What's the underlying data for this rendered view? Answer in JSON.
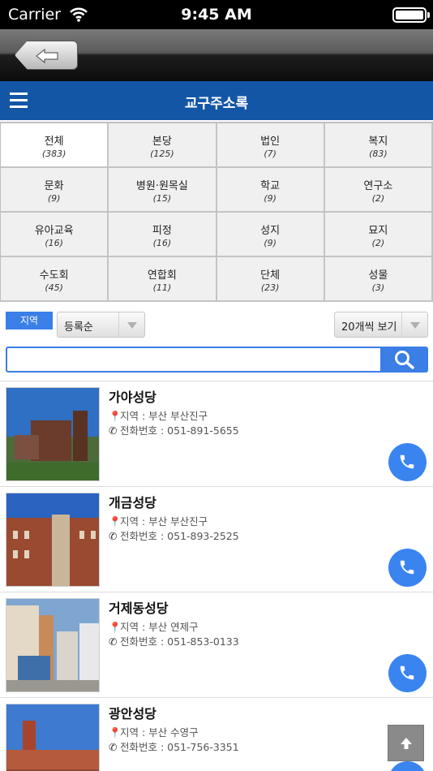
{
  "status_bar": {
    "carrier": "Carrier",
    "time": "9:45 AM"
  },
  "header": {
    "title": "교구주소록"
  },
  "categories": [
    {
      "name": "전체",
      "count": "(383)"
    },
    {
      "name": "본당",
      "count": "(125)"
    },
    {
      "name": "법인",
      "count": "(7)"
    },
    {
      "name": "복지",
      "count": "(83)"
    },
    {
      "name": "문화",
      "count": "(9)"
    },
    {
      "name": "병원·원목실",
      "count": "(15)"
    },
    {
      "name": "학교",
      "count": "(9)"
    },
    {
      "name": "연구소",
      "count": "(2)"
    },
    {
      "name": "유아교육",
      "count": "(16)"
    },
    {
      "name": "피정",
      "count": "(16)"
    },
    {
      "name": "성지",
      "count": "(9)"
    },
    {
      "name": "묘지",
      "count": "(2)"
    },
    {
      "name": "수도회",
      "count": "(45)"
    },
    {
      "name": "연합회",
      "count": "(11)"
    },
    {
      "name": "단체",
      "count": "(23)"
    },
    {
      "name": "성물",
      "count": "(3)"
    }
  ],
  "filters": {
    "region_label": "지역",
    "sort_value": "등록순",
    "page_size_value": "20개씩 보기"
  },
  "search": {
    "value": "",
    "placeholder": ""
  },
  "list": [
    {
      "name": "가야성당",
      "region": "지역 : 부산 부산진구",
      "phone": "전화번호 : 051-891-5655"
    },
    {
      "name": "개금성당",
      "region": "지역 : 부산 부산진구",
      "phone": "전화번호 : 051-893-2525"
    },
    {
      "name": "거제동성당",
      "region": "지역 : 부산 연제구",
      "phone": "전화번호 : 051-853-0133"
    },
    {
      "name": "광안성당",
      "region": "지역 : 부산 수영구",
      "phone": "전화번호 : 051-756-3351"
    }
  ],
  "icons": {
    "back": "arrow-left-icon",
    "menu": "hamburger-menu-icon",
    "search": "search-icon",
    "location": "map-pin-icon",
    "phone": "phone-icon",
    "call": "phone-call-icon",
    "scroll_top": "arrow-up-icon"
  },
  "colors": {
    "header_blue": "#1456a6",
    "accent_blue": "#3a7ee6",
    "call_blue": "#3a84f0"
  }
}
